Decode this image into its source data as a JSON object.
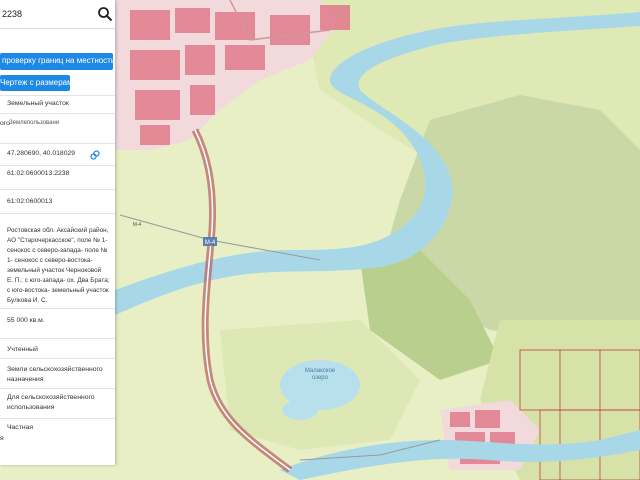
{
  "search": {
    "value": "2238"
  },
  "panel": {
    "check_button_label": "проверку границ на местности",
    "draw_button_label": "Чертеж с размерами",
    "title": "Земельный участок",
    "status_text": "Землепользовани",
    "status_prefix": "ого",
    "coordinates": "47.280690, 40.018029",
    "cad_number": "61:02:0600013:2238",
    "quarter": "61:02:0600013",
    "address": "Ростовская обл. Аксайский район,\nАО \"Старочеркасское\", поле № 1-\nсенокос с северо-запада- поле №\n1- сенокос с северо-востока-\nземельный участок Черноковой\nЕ. П.; с юго-запада- ох. Два Брата;\nс юго-востока- земельный участок\nБулкова И. С.",
    "area": "55 000 кв.м.",
    "category_status": "Учтенный",
    "land_category": "Земли сельскохозяйственного\nназначения",
    "permitted_use": "Для сельскохозяйственного\nиспользования",
    "ownership": "Частная",
    "ownership_suffix": "я"
  },
  "map": {
    "road_label": "М-4",
    "road_label_2": "М-4",
    "lake_labels": [
      "Малакское\nозеро"
    ],
    "water_color": "#a8d8e8",
    "land_color": "#e8efc4",
    "forest_color": "#c9d8a6",
    "urban_color": "#e07a8a",
    "highlight_color": "#b85c5c"
  }
}
